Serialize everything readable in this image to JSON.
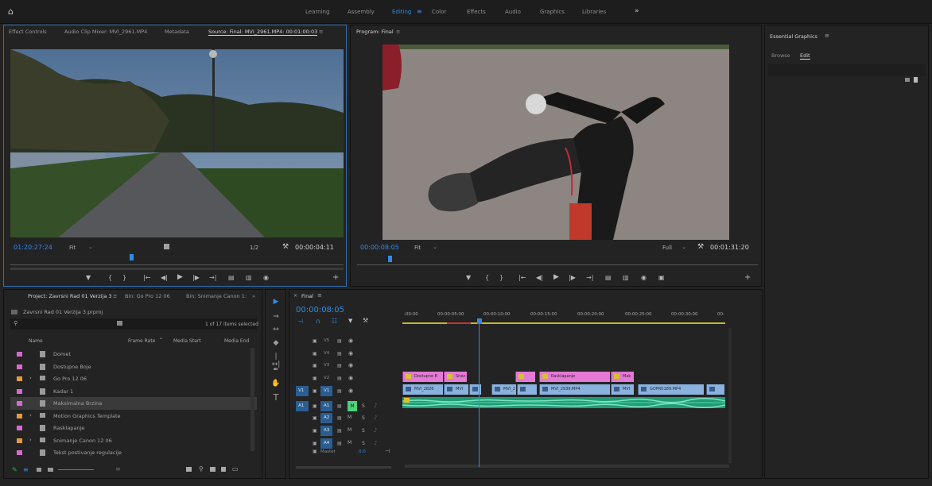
{
  "workspace_tabs": [
    "Learning",
    "Assembly",
    "Editing",
    "Color",
    "Effects",
    "Audio",
    "Graphics",
    "Libraries"
  ],
  "workspace_active": "Editing",
  "source_panel": {
    "tabs": [
      "Effect Controls",
      "Audio Clip Mixer: MVI_2961.MP4",
      "Metadata",
      "Source: Final: MVI_2961.MP4: 00:01:00:03"
    ],
    "timecode": "01:20:27:24",
    "fit": "Fit",
    "resolution": "1/2",
    "duration": "00:00:04:11"
  },
  "program_panel": {
    "title": "Program: Final",
    "timecode": "00:00:08:05",
    "fit": "Fit",
    "resolution": "Full",
    "duration": "00:01:31:20"
  },
  "essential_graphics": {
    "title": "Essential Graphics",
    "tabs": [
      "Browse",
      "Edit"
    ],
    "active_tab": "Edit"
  },
  "project_panel": {
    "tabs": [
      "Project: Zavrsni Rad 01 Verzija 3",
      "Bin: Go Pro 12 06",
      "Bin: Snimanje Canon 1:"
    ],
    "file": "Zavrsni Rad 01 Verzija 3.prproj",
    "count": "1 of 17 items selected",
    "columns": [
      "Name",
      "Frame Rate",
      "Media Start",
      "Media End"
    ],
    "items": [
      {
        "name": "Domet",
        "color": "#d66ad0",
        "folder": false
      },
      {
        "name": "Dostupne Boje",
        "color": "#d66ad0",
        "folder": false
      },
      {
        "name": "Go Pro 12 06",
        "color": "#e49b3a",
        "folder": true
      },
      {
        "name": "Kadar 1",
        "color": "#d66ad0",
        "folder": false
      },
      {
        "name": "Maksimalna Brzina",
        "color": "#d66ad0",
        "folder": false
      },
      {
        "name": "Motion Graphics Template",
        "color": "#e49b3a",
        "folder": true
      },
      {
        "name": "Rasklapanje",
        "color": "#d66ad0",
        "folder": false
      },
      {
        "name": "Snimanje Canon 12 06",
        "color": "#e49b3a",
        "folder": true
      },
      {
        "name": "Tekst postivanje regulacije",
        "color": "#d66ad0",
        "folder": false
      }
    ]
  },
  "timeline": {
    "title": "Final",
    "timecode": "00:00:08:05",
    "ruler": [
      ":00:00",
      "00:00:05:00",
      "00:00:10:00",
      "00:00:15:00",
      "00:00:20:00",
      "00:00:25:00",
      "00:00:30:00",
      "00:"
    ],
    "video_tracks": [
      "V5",
      "V4",
      "V3",
      "V2",
      "V1"
    ],
    "audio_tracks": [
      "A1",
      "A2",
      "A3",
      "A4"
    ],
    "master_label": "Master",
    "master_value": "0.0",
    "v1_source": "V1",
    "a1_source": "A1",
    "v2_clips": [
      {
        "label": "Dostupne B",
        "start": 0,
        "end": 52
      },
      {
        "label": "Snez",
        "start": 52,
        "end": 82
      },
      {
        "label": "",
        "start": 142,
        "end": 168
      },
      {
        "label": "Rasklapanje",
        "start": 172,
        "end": 262
      },
      {
        "label": "Mak",
        "start": 262,
        "end": 292
      }
    ],
    "v1_clips": [
      {
        "label": "MVI_2826",
        "start": 0,
        "end": 52
      },
      {
        "label": "MVI",
        "start": 52,
        "end": 84
      },
      {
        "label": "",
        "start": 84,
        "end": 100
      },
      {
        "label": "MVI_2",
        "start": 112,
        "end": 144
      },
      {
        "label": "",
        "start": 144,
        "end": 170
      },
      {
        "label": "MVI_2939.MP4",
        "start": 172,
        "end": 262
      },
      {
        "label": "MVI",
        "start": 262,
        "end": 292
      },
      {
        "label": "GOPR0189.MP4",
        "start": 296,
        "end": 380
      },
      {
        "label": "",
        "start": 382,
        "end": 406
      }
    ]
  }
}
